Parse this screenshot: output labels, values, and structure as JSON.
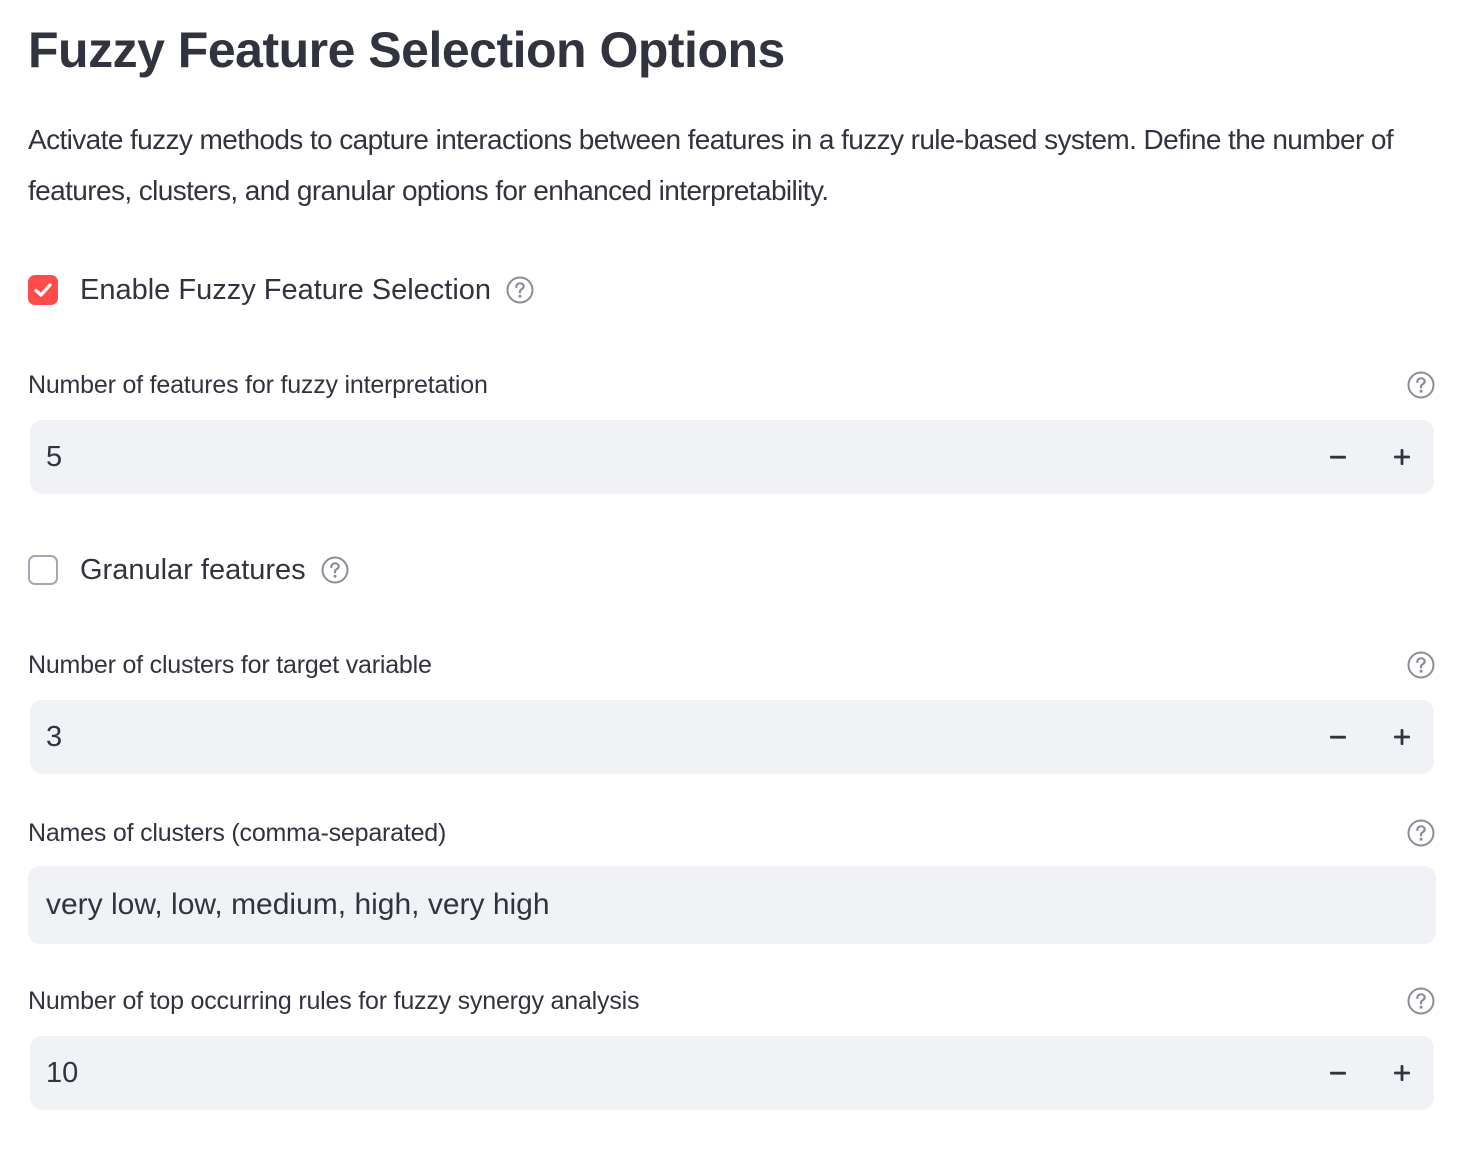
{
  "header": {
    "title": "Fuzzy Feature Selection Options",
    "description": "Activate fuzzy methods to capture interactions between features in a fuzzy rule-based system. Define the number of features, clusters, and granular options for enhanced interpretability."
  },
  "colors": {
    "accent": "#ff4b4b",
    "input_background": "#f0f2f6",
    "text": "#31333f"
  },
  "enable_fuzzy": {
    "label": "Enable Fuzzy Feature Selection",
    "checked": true,
    "help_icon": "question-circle-icon"
  },
  "num_features": {
    "label": "Number of features for fuzzy interpretation",
    "value": "5",
    "decrement_icon": "minus-icon",
    "increment_icon": "plus-icon"
  },
  "granular": {
    "label": "Granular features",
    "checked": false,
    "help_icon": "question-circle-icon"
  },
  "num_clusters": {
    "label": "Number of clusters for target variable",
    "value": "3",
    "decrement_icon": "minus-icon",
    "increment_icon": "plus-icon"
  },
  "cluster_names": {
    "label": "Names of clusters (comma-separated)",
    "value": "very low, low, medium, high, very high"
  },
  "top_rules": {
    "label": "Number of top occurring rules for fuzzy synergy analysis",
    "value": "10",
    "decrement_icon": "minus-icon",
    "increment_icon": "plus-icon"
  }
}
